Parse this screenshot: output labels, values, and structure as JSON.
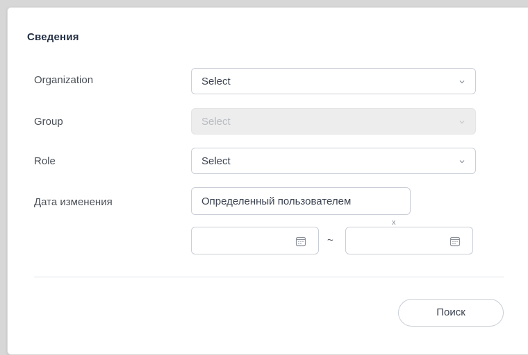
{
  "panel": {
    "title": "Сведения"
  },
  "form": {
    "organization": {
      "label": "Organization",
      "value": "Select"
    },
    "group": {
      "label": "Group",
      "value": "Select",
      "disabled": true
    },
    "role": {
      "label": "Role",
      "value": "Select"
    },
    "date_changed": {
      "label": "Дата изменения",
      "mode_value": "Определенный пользователем",
      "range_separator": "~",
      "stray_mark": "x"
    }
  },
  "actions": {
    "search_label": "Поиск"
  },
  "icons": {
    "chevron": "chevron-down-icon",
    "calendar": "calendar-icon"
  },
  "colors": {
    "title": "#243044",
    "border": "#c9ced6",
    "disabled_bg": "#ededed"
  }
}
